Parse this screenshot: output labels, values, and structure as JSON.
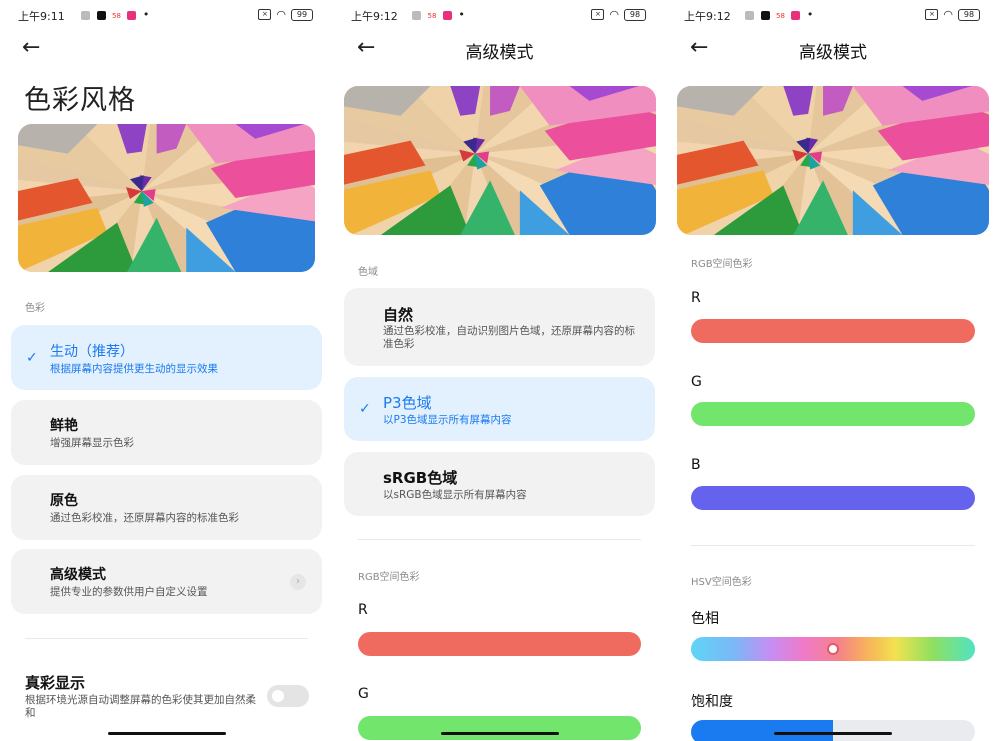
{
  "status": {
    "p1": {
      "time": "上午9:11",
      "battery": "99"
    },
    "p2": {
      "time": "上午9:12",
      "battery": "98"
    },
    "p3": {
      "time": "上午9:12",
      "battery": "98"
    },
    "app_badge": "58",
    "dot": "•"
  },
  "back_glyph": "←",
  "panel1": {
    "title": "色彩风格",
    "section_label": "色彩",
    "options": [
      {
        "title": "生动（推荐）",
        "subtitle": "根据屏幕内容提供更生动的显示效果",
        "selected": true
      },
      {
        "title": "鲜艳",
        "subtitle": "增强屏幕显示色彩",
        "selected": false
      },
      {
        "title": "原色",
        "subtitle": "通过色彩校准，还原屏幕内容的标准色彩",
        "selected": false
      },
      {
        "title": "高级模式",
        "subtitle": "提供专业的参数供用户自定义设置",
        "selected": false
      }
    ],
    "true_color": {
      "title": "真彩显示",
      "subtitle": "根据环境光源自动调整屏幕的色彩使其更加自然柔和",
      "enabled": false
    }
  },
  "panel2": {
    "title": "高级模式",
    "gamut_label": "色域",
    "options": [
      {
        "title": "自然",
        "subtitle": "通过色彩校准，自动识别图片色域，还原屏幕内容的标准色彩",
        "selected": false
      },
      {
        "title": "P3色域",
        "subtitle": "以P3色域显示所有屏幕内容",
        "selected": true
      },
      {
        "title": "sRGB色域",
        "subtitle": "以sRGB色域显示所有屏幕内容",
        "selected": false
      }
    ],
    "rgb_label": "RGB空间色彩",
    "r_label": "R",
    "g_label": "G"
  },
  "panel3": {
    "title": "高级模式",
    "rgb_label": "RGB空间色彩",
    "r_label": "R",
    "g_label": "G",
    "b_label": "B",
    "hsv_label": "HSV空间色彩",
    "hue_label": "色相",
    "hue_position": 0.5,
    "saturation_label": "饱和度",
    "saturation_value": 0.5
  },
  "colors": {
    "accent": "#1a7af0",
    "red_bar": "#ef6a5f",
    "green_bar": "#72e56c",
    "blue_bar": "#6562ee",
    "sat_fill": "#1a7af0",
    "sat_track": "#e9ebef"
  },
  "icons": {
    "check": "✓",
    "chevron": "›",
    "wifi": "wifi-icon",
    "signal": "signal-icon"
  }
}
